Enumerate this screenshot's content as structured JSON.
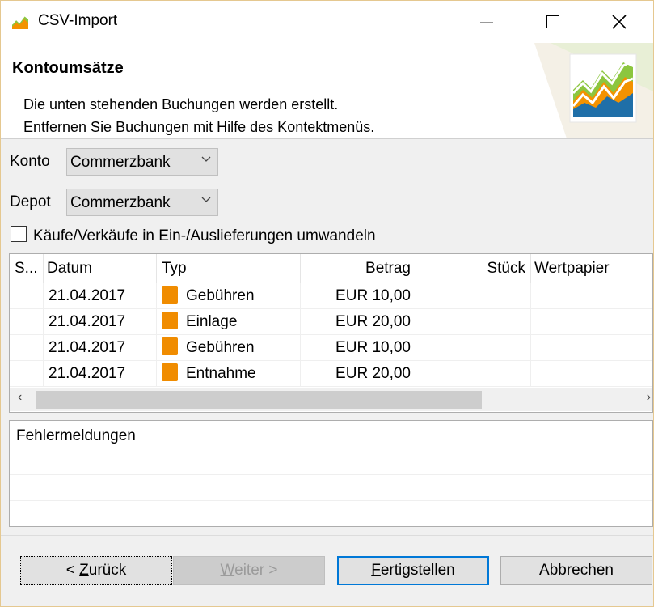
{
  "window": {
    "title": "CSV-Import",
    "controls": {
      "minimize": "–",
      "maximize": "☐",
      "close": "✕"
    }
  },
  "header": {
    "title": "Kontoumsätze",
    "description_line1": "Die unten stehenden Buchungen werden erstellt.",
    "description_line2": "Entfernen Sie Buchungen mit Hilfe des Kontektmenüs."
  },
  "form": {
    "konto_label": "Konto",
    "konto_value": "Commerzbank",
    "depot_label": "Depot",
    "depot_value": "Commerzbank",
    "checkbox_label": "Käufe/Verkäufe in Ein-/Auslieferungen umwandeln",
    "checkbox_checked": false
  },
  "table": {
    "columns": [
      "S...",
      "Datum",
      "Typ",
      "Betrag",
      "Stück",
      "Wertpapier"
    ],
    "rows": [
      {
        "status": "",
        "datum": "21.04.2017",
        "typ": "Gebühren",
        "betrag": "EUR 10,00",
        "stueck": "",
        "wertpapier": ""
      },
      {
        "status": "",
        "datum": "21.04.2017",
        "typ": "Einlage",
        "betrag": "EUR 20,00",
        "stueck": "",
        "wertpapier": ""
      },
      {
        "status": "",
        "datum": "21.04.2017",
        "typ": "Gebühren",
        "betrag": "EUR 10,00",
        "stueck": "",
        "wertpapier": ""
      },
      {
        "status": "",
        "datum": "21.04.2017",
        "typ": "Entnahme",
        "betrag": "EUR 20,00",
        "stueck": "",
        "wertpapier": ""
      }
    ],
    "scroll_left": "‹",
    "scroll_right": "›"
  },
  "errors": {
    "title": "Fehlermeldungen"
  },
  "buttons": {
    "back_prefix": "< ",
    "back_mnemonic": "Z",
    "back_rest": "urück",
    "next_mnemonic": "W",
    "next_rest": "eiter >",
    "finish_mnemonic": "F",
    "finish_rest": "ertigstellen",
    "cancel": "Abbrechen"
  },
  "colors": {
    "accent": "#0078d7",
    "type_icon": "#f08c00",
    "banner_green": "#8cc63f",
    "banner_orange": "#f39200",
    "banner_blue": "#1f6fa8"
  },
  "icons": {
    "app": "chart-icon",
    "type": "transaction-type-icon",
    "combo": "chevron-down-icon"
  }
}
